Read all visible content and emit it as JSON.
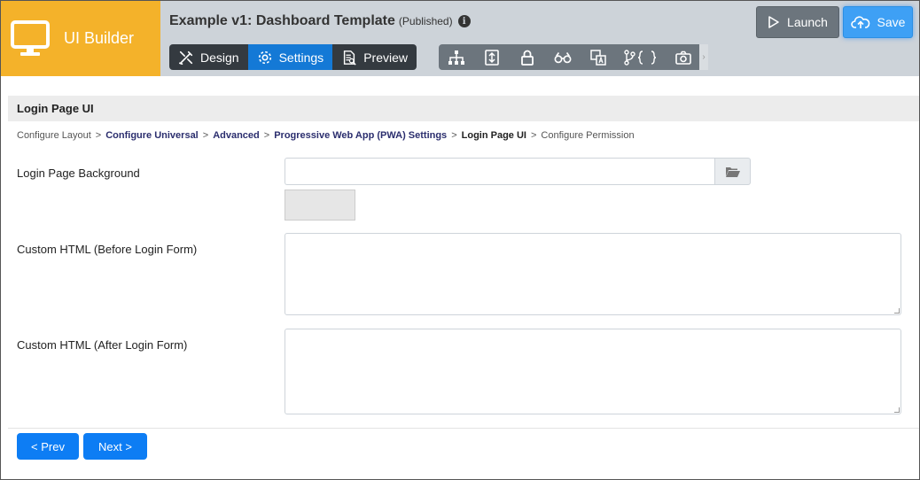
{
  "app": {
    "name": "UI Builder"
  },
  "header": {
    "title": "Example v1: Dashboard Template",
    "status": "(Published)",
    "info_glyph": "i",
    "modes": [
      {
        "label": "Design",
        "icon": "design-tools-icon",
        "active": false
      },
      {
        "label": "Settings",
        "icon": "gear-icon",
        "active": true
      },
      {
        "label": "Preview",
        "icon": "preview-document-icon",
        "active": false
      }
    ],
    "tools": [
      "sitemap-icon",
      "import-export-icon",
      "lock-icon",
      "binoculars-icon",
      "translate-icon",
      "code-branch-icon",
      "camera-icon"
    ],
    "launch_label": "Launch",
    "save_label": "Save"
  },
  "section": {
    "title": "Login Page UI"
  },
  "breadcrumb": [
    {
      "label": "Configure Layout",
      "type": "plain"
    },
    {
      "label": "Configure Universal",
      "type": "link"
    },
    {
      "label": "Advanced",
      "type": "link"
    },
    {
      "label": "Progressive Web App (PWA) Settings",
      "type": "link"
    },
    {
      "label": "Login Page UI",
      "type": "current"
    },
    {
      "label": "Configure Permission",
      "type": "plain"
    }
  ],
  "breadcrumb_separator": ">",
  "form": {
    "background_label": "Login Page Background",
    "background_value": "",
    "before_label": "Custom HTML (Before Login Form)",
    "before_value": "",
    "after_label": "Custom HTML (After Login Form)",
    "after_value": ""
  },
  "nav": {
    "prev_label": "< Prev",
    "next_label": "Next >"
  },
  "colors": {
    "logo_bg": "#f4b22a",
    "header_bg": "#cdd3d9",
    "accent": "#1479d6",
    "primary_button": "#0d7df4"
  }
}
